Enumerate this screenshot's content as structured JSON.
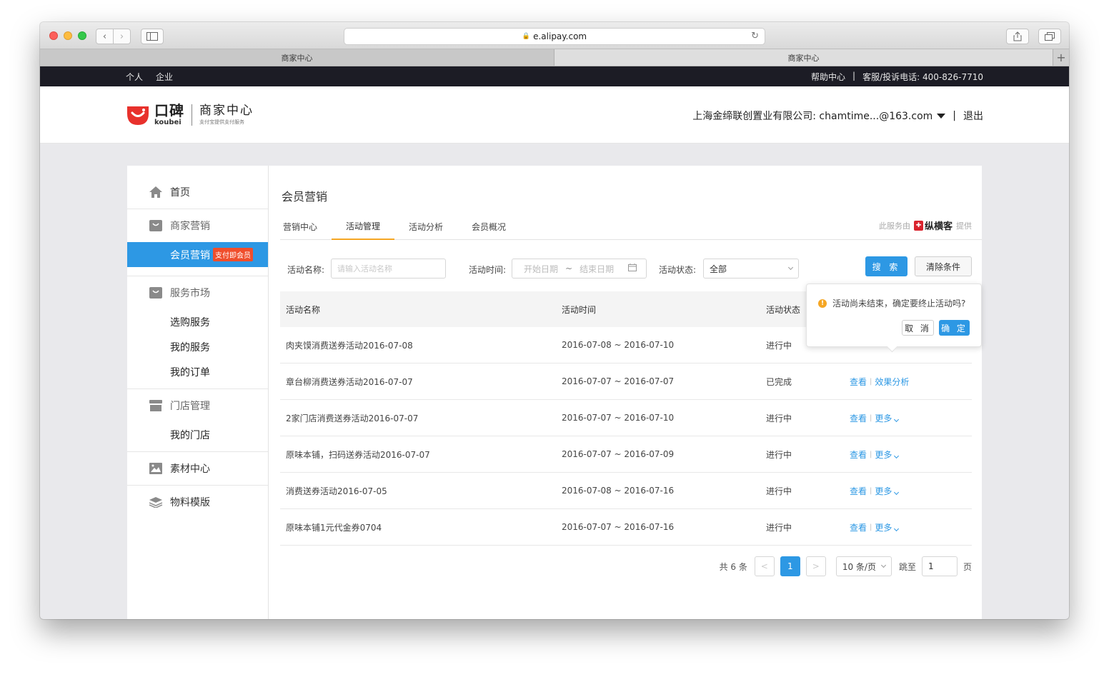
{
  "browser": {
    "url": "e.alipay.com",
    "tabs": [
      {
        "label": "商家中心"
      },
      {
        "label": "商家中心"
      }
    ]
  },
  "topbar": {
    "left": [
      "个人",
      "企业"
    ],
    "help": "帮助中心",
    "divider": "|",
    "hotline": "客服/投诉电话: 400-826-7710"
  },
  "header": {
    "logo_cn": "口碑",
    "logo_en": "koubei",
    "product": "商家中心",
    "product_sub": "支付宝提供支付服务",
    "account": "上海金缔联创置业有限公司: chamtime...@163.com",
    "divider": "|",
    "logout": "退出"
  },
  "sidebar": {
    "home": "首页",
    "marketing": "商家营销",
    "member_marketing": "会员营销",
    "member_badge": "支付即会员",
    "service_market": "服务市场",
    "service_items": [
      "选购服务",
      "我的服务",
      "我的订单"
    ],
    "store_mgmt": "门店管理",
    "store_items": [
      "我的门店"
    ],
    "material": "素材中心",
    "template": "物料模版"
  },
  "content": {
    "title": "会员营销",
    "tabs": [
      "营销中心",
      "活动管理",
      "活动分析",
      "会员概况"
    ],
    "powered_prefix": "此服务由",
    "powered_brand": "纵横客",
    "powered_suffix": "提供"
  },
  "filters": {
    "name_label": "活动名称:",
    "name_placeholder": "请输入活动名称",
    "time_label": "活动时间:",
    "start_placeholder": "开始日期",
    "range_sep": "~",
    "end_placeholder": "结束日期",
    "status_label": "活动状态:",
    "status_value": "全部",
    "search": "搜 索",
    "clear": "清除条件"
  },
  "table": {
    "headers": [
      "活动名称",
      "活动时间",
      "活动状态"
    ],
    "rows": [
      {
        "name": "肉夹馍消费送券活动2016-07-08",
        "time": "2016-07-08 ~ 2016-07-10",
        "status": "进行中"
      },
      {
        "name": "章台柳消费送券活动2016-07-07",
        "time": "2016-07-07 ~ 2016-07-07",
        "status": "已完成",
        "a1": "查看",
        "a2": "效果分析"
      },
      {
        "name": "2家门店消费送券活动2016-07-07",
        "time": "2016-07-07 ~ 2016-07-10",
        "status": "进行中",
        "a1": "查看",
        "a2": "更多"
      },
      {
        "name": "原味本铺，扫码送券活动2016-07-07",
        "time": "2016-07-07 ~ 2016-07-09",
        "status": "进行中",
        "a1": "查看",
        "a2": "更多"
      },
      {
        "name": "消费送券活动2016-07-05",
        "time": "2016-07-08 ~ 2016-07-16",
        "status": "进行中",
        "a1": "查看",
        "a2": "更多"
      },
      {
        "name": "原味本铺1元代金券0704",
        "time": "2016-07-07 ~ 2016-07-16",
        "status": "进行中",
        "a1": "查看",
        "a2": "更多"
      }
    ]
  },
  "pagination": {
    "total": "共 6 条",
    "prev": "<",
    "current": "1",
    "next": ">",
    "page_size": "10 条/页",
    "jump_label": "跳至",
    "jump_value": "1",
    "page_unit": "页"
  },
  "popover": {
    "message": "活动尚未结束，确定要终止活动吗?",
    "cancel": "取 消",
    "ok": "确 定"
  },
  "colors": {
    "accent": "#2d98e4",
    "active_tab": "#f5a623",
    "badge": "#f04e2c",
    "topbar": "#1c1c25"
  }
}
